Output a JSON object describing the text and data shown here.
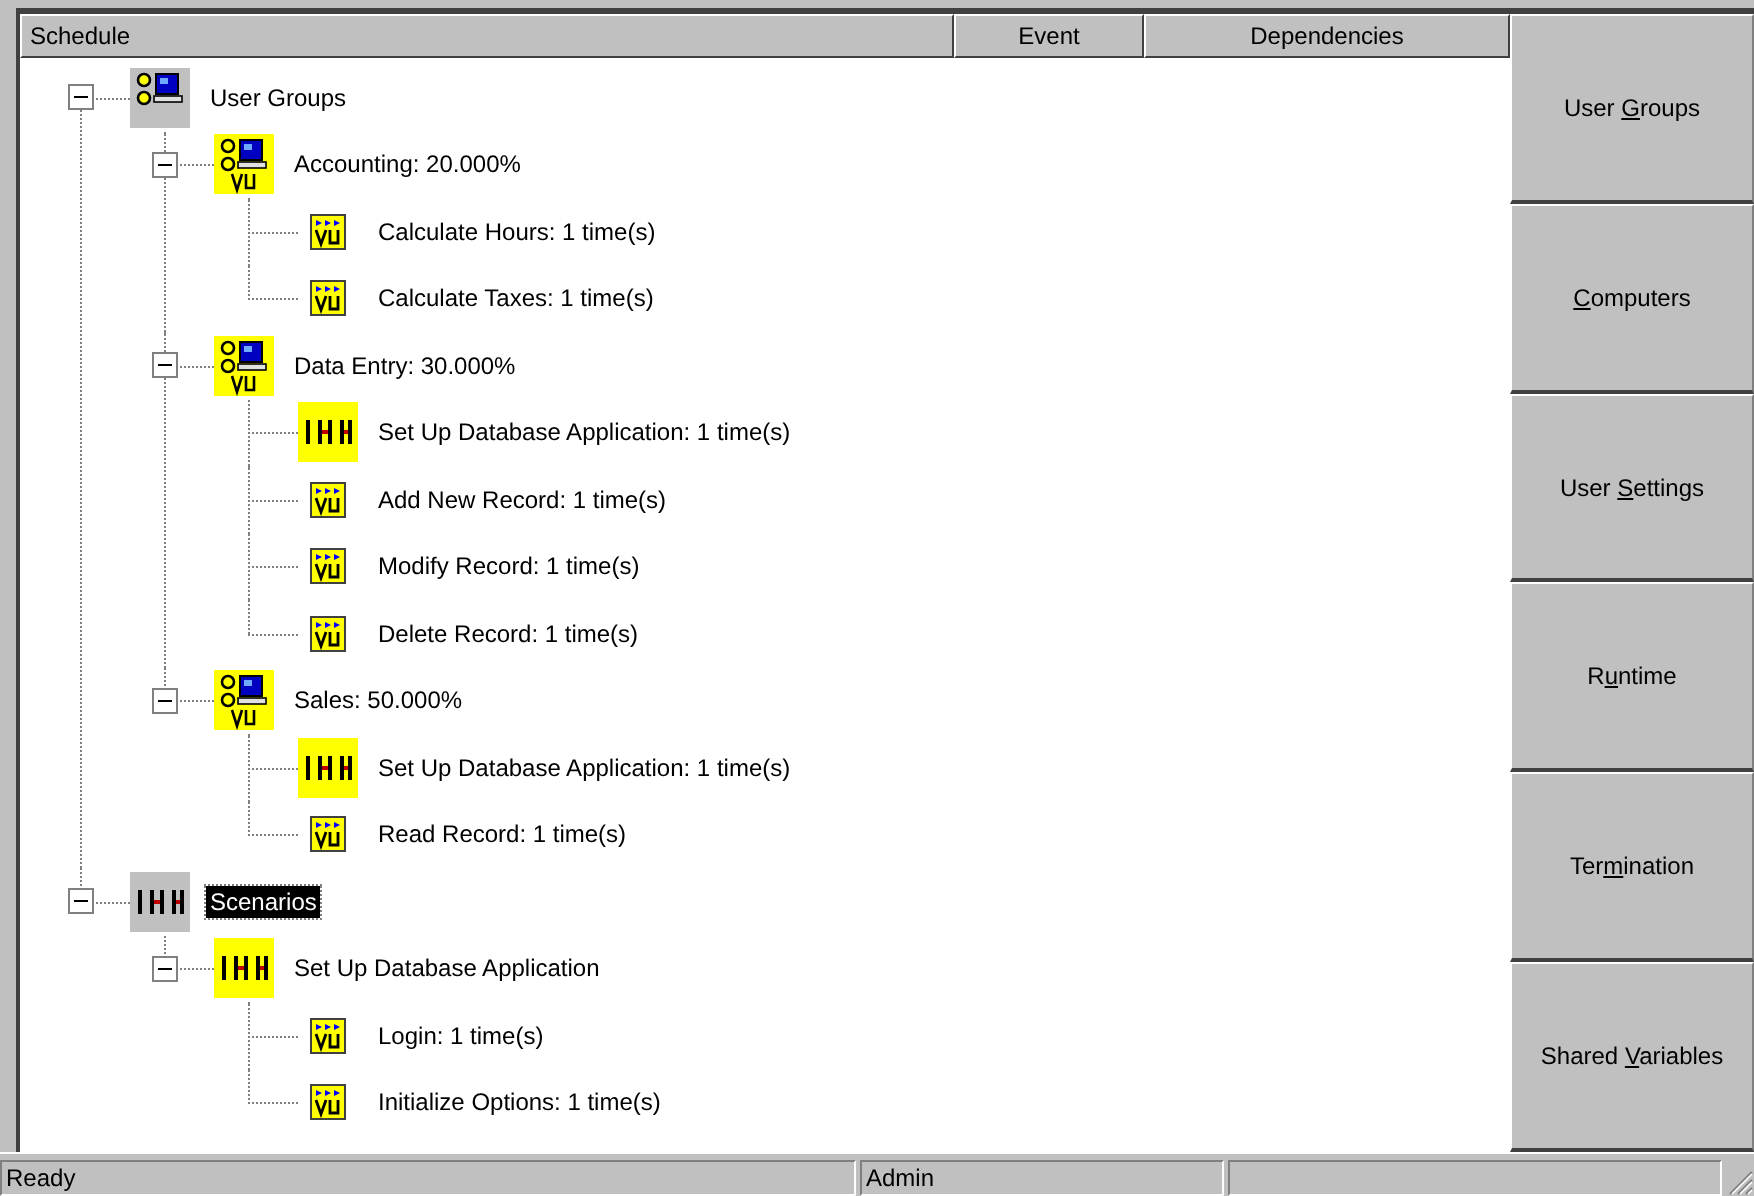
{
  "header": {
    "columns": [
      "Schedule",
      "Event",
      "Dependencies"
    ]
  },
  "tree": [
    {
      "kind": "user-groups",
      "label": "User Groups",
      "expanded": true,
      "selected": false,
      "children": [
        {
          "kind": "group",
          "label": "Accounting: 20.000%",
          "expanded": true,
          "selected": false,
          "children": [
            {
              "kind": "script",
              "label": "Calculate Hours: 1 time(s)",
              "selected": false
            },
            {
              "kind": "script",
              "label": "Calculate Taxes: 1 time(s)",
              "selected": false
            }
          ]
        },
        {
          "kind": "group",
          "label": "Data Entry: 30.000%",
          "expanded": true,
          "selected": false,
          "children": [
            {
              "kind": "suite",
              "label": "Set Up Database Application: 1 time(s)",
              "selected": false
            },
            {
              "kind": "script",
              "label": "Add New Record: 1 time(s)",
              "selected": false
            },
            {
              "kind": "script",
              "label": "Modify Record: 1 time(s)",
              "selected": false
            },
            {
              "kind": "script",
              "label": "Delete Record: 1 time(s)",
              "selected": false
            }
          ]
        },
        {
          "kind": "group",
          "label": "Sales: 50.000%",
          "expanded": true,
          "selected": false,
          "children": [
            {
              "kind": "suite",
              "label": "Set Up Database Application: 1 time(s)",
              "selected": false
            },
            {
              "kind": "script",
              "label": "Read Record: 1 time(s)",
              "selected": false
            }
          ]
        }
      ]
    },
    {
      "kind": "scenarios",
      "label": "Scenarios",
      "expanded": true,
      "selected": true,
      "children": [
        {
          "kind": "suite",
          "label": "Set Up Database Application",
          "expanded": true,
          "selected": false,
          "children": [
            {
              "kind": "script",
              "label": "Login: 1 time(s)",
              "selected": false
            },
            {
              "kind": "script",
              "label": "Initialize Options: 1 time(s)",
              "selected": false
            }
          ]
        }
      ]
    }
  ],
  "side_buttons": [
    {
      "before": "User ",
      "key": "G",
      "after": "roups"
    },
    {
      "key": "C",
      "after": "omputers"
    },
    {
      "before": "User ",
      "key": "S",
      "after": "ettings"
    },
    {
      "before": "R",
      "key": "u",
      "after": "ntime"
    },
    {
      "before": "Ter",
      "key": "m",
      "after": "ination"
    },
    {
      "before": "Shared ",
      "key": "V",
      "after": "ariables"
    }
  ],
  "status_bar": [
    "Ready",
    "Admin"
  ]
}
